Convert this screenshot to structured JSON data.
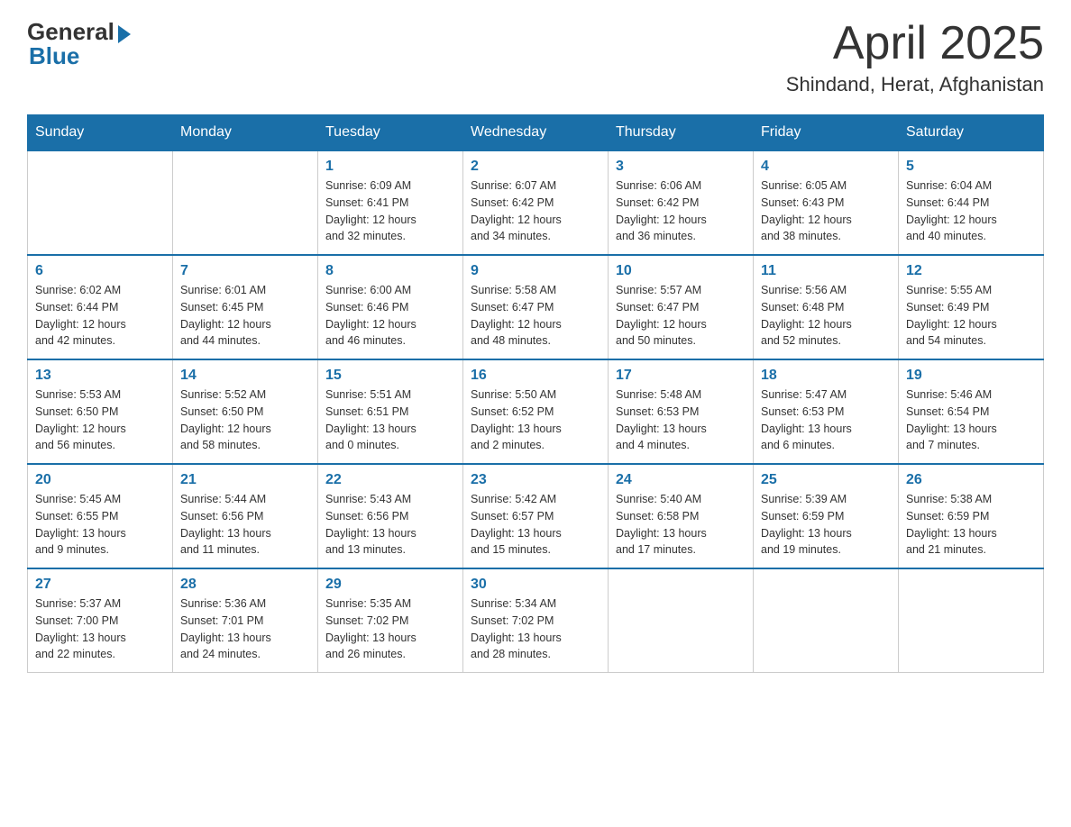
{
  "header": {
    "logo_general": "General",
    "logo_blue": "Blue",
    "title": "April 2025",
    "location": "Shindand, Herat, Afghanistan"
  },
  "calendar": {
    "days_of_week": [
      "Sunday",
      "Monday",
      "Tuesday",
      "Wednesday",
      "Thursday",
      "Friday",
      "Saturday"
    ],
    "weeks": [
      [
        {
          "day": "",
          "info": ""
        },
        {
          "day": "",
          "info": ""
        },
        {
          "day": "1",
          "info": "Sunrise: 6:09 AM\nSunset: 6:41 PM\nDaylight: 12 hours\nand 32 minutes."
        },
        {
          "day": "2",
          "info": "Sunrise: 6:07 AM\nSunset: 6:42 PM\nDaylight: 12 hours\nand 34 minutes."
        },
        {
          "day": "3",
          "info": "Sunrise: 6:06 AM\nSunset: 6:42 PM\nDaylight: 12 hours\nand 36 minutes."
        },
        {
          "day": "4",
          "info": "Sunrise: 6:05 AM\nSunset: 6:43 PM\nDaylight: 12 hours\nand 38 minutes."
        },
        {
          "day": "5",
          "info": "Sunrise: 6:04 AM\nSunset: 6:44 PM\nDaylight: 12 hours\nand 40 minutes."
        }
      ],
      [
        {
          "day": "6",
          "info": "Sunrise: 6:02 AM\nSunset: 6:44 PM\nDaylight: 12 hours\nand 42 minutes."
        },
        {
          "day": "7",
          "info": "Sunrise: 6:01 AM\nSunset: 6:45 PM\nDaylight: 12 hours\nand 44 minutes."
        },
        {
          "day": "8",
          "info": "Sunrise: 6:00 AM\nSunset: 6:46 PM\nDaylight: 12 hours\nand 46 minutes."
        },
        {
          "day": "9",
          "info": "Sunrise: 5:58 AM\nSunset: 6:47 PM\nDaylight: 12 hours\nand 48 minutes."
        },
        {
          "day": "10",
          "info": "Sunrise: 5:57 AM\nSunset: 6:47 PM\nDaylight: 12 hours\nand 50 minutes."
        },
        {
          "day": "11",
          "info": "Sunrise: 5:56 AM\nSunset: 6:48 PM\nDaylight: 12 hours\nand 52 minutes."
        },
        {
          "day": "12",
          "info": "Sunrise: 5:55 AM\nSunset: 6:49 PM\nDaylight: 12 hours\nand 54 minutes."
        }
      ],
      [
        {
          "day": "13",
          "info": "Sunrise: 5:53 AM\nSunset: 6:50 PM\nDaylight: 12 hours\nand 56 minutes."
        },
        {
          "day": "14",
          "info": "Sunrise: 5:52 AM\nSunset: 6:50 PM\nDaylight: 12 hours\nand 58 minutes."
        },
        {
          "day": "15",
          "info": "Sunrise: 5:51 AM\nSunset: 6:51 PM\nDaylight: 13 hours\nand 0 minutes."
        },
        {
          "day": "16",
          "info": "Sunrise: 5:50 AM\nSunset: 6:52 PM\nDaylight: 13 hours\nand 2 minutes."
        },
        {
          "day": "17",
          "info": "Sunrise: 5:48 AM\nSunset: 6:53 PM\nDaylight: 13 hours\nand 4 minutes."
        },
        {
          "day": "18",
          "info": "Sunrise: 5:47 AM\nSunset: 6:53 PM\nDaylight: 13 hours\nand 6 minutes."
        },
        {
          "day": "19",
          "info": "Sunrise: 5:46 AM\nSunset: 6:54 PM\nDaylight: 13 hours\nand 7 minutes."
        }
      ],
      [
        {
          "day": "20",
          "info": "Sunrise: 5:45 AM\nSunset: 6:55 PM\nDaylight: 13 hours\nand 9 minutes."
        },
        {
          "day": "21",
          "info": "Sunrise: 5:44 AM\nSunset: 6:56 PM\nDaylight: 13 hours\nand 11 minutes."
        },
        {
          "day": "22",
          "info": "Sunrise: 5:43 AM\nSunset: 6:56 PM\nDaylight: 13 hours\nand 13 minutes."
        },
        {
          "day": "23",
          "info": "Sunrise: 5:42 AM\nSunset: 6:57 PM\nDaylight: 13 hours\nand 15 minutes."
        },
        {
          "day": "24",
          "info": "Sunrise: 5:40 AM\nSunset: 6:58 PM\nDaylight: 13 hours\nand 17 minutes."
        },
        {
          "day": "25",
          "info": "Sunrise: 5:39 AM\nSunset: 6:59 PM\nDaylight: 13 hours\nand 19 minutes."
        },
        {
          "day": "26",
          "info": "Sunrise: 5:38 AM\nSunset: 6:59 PM\nDaylight: 13 hours\nand 21 minutes."
        }
      ],
      [
        {
          "day": "27",
          "info": "Sunrise: 5:37 AM\nSunset: 7:00 PM\nDaylight: 13 hours\nand 22 minutes."
        },
        {
          "day": "28",
          "info": "Sunrise: 5:36 AM\nSunset: 7:01 PM\nDaylight: 13 hours\nand 24 minutes."
        },
        {
          "day": "29",
          "info": "Sunrise: 5:35 AM\nSunset: 7:02 PM\nDaylight: 13 hours\nand 26 minutes."
        },
        {
          "day": "30",
          "info": "Sunrise: 5:34 AM\nSunset: 7:02 PM\nDaylight: 13 hours\nand 28 minutes."
        },
        {
          "day": "",
          "info": ""
        },
        {
          "day": "",
          "info": ""
        },
        {
          "day": "",
          "info": ""
        }
      ]
    ]
  }
}
